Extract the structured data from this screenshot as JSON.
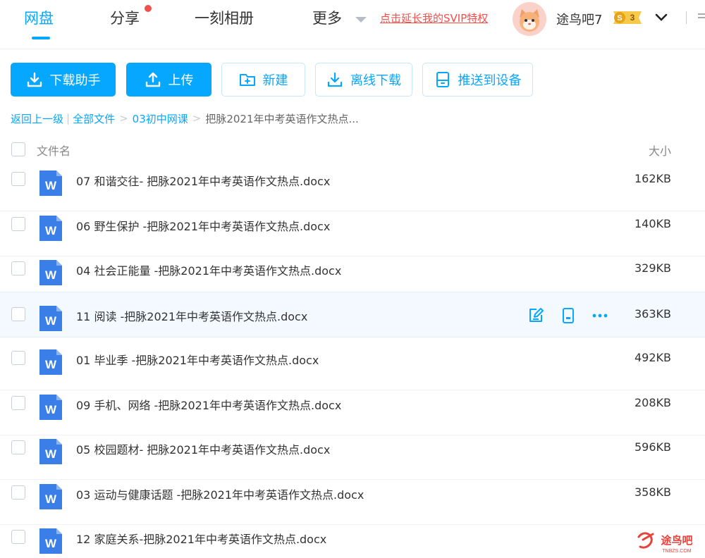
{
  "nav": {
    "items": [
      {
        "label": "网盘",
        "active": true
      },
      {
        "label": "分享",
        "has_dot": true
      },
      {
        "label": "一刻相册"
      },
      {
        "label": "更多"
      }
    ],
    "svip_link": "点击延长我的SVIP特权",
    "username": "途鸟吧7",
    "level_badge": {
      "symbol": "S",
      "level": "3"
    }
  },
  "toolbar": [
    {
      "label": "下载助手",
      "icon": "download-icon",
      "style": "primary"
    },
    {
      "label": "上传",
      "icon": "upload-icon",
      "style": "primary"
    },
    {
      "label": "新建",
      "icon": "new-folder-icon",
      "style": "outline"
    },
    {
      "label": "离线下载",
      "icon": "offline-download-icon",
      "style": "outline"
    },
    {
      "label": "推送到设备",
      "icon": "push-device-icon",
      "style": "outline"
    }
  ],
  "breadcrumb": {
    "back": "返回上一级",
    "all_files": "全部文件",
    "folder": "03初中网课",
    "current": "把脉2021年中考英语作文热点..."
  },
  "list_header": {
    "name": "文件名",
    "size": "大小"
  },
  "files": [
    {
      "icon": "word-doc-icon",
      "name": "07 和谐交往- 把脉2021年中考英语作文热点.docx",
      "size": "162KB"
    },
    {
      "icon": "word-doc-icon",
      "name": "06 野生保护 -把脉2021年中考英语作文热点.docx",
      "size": "140KB"
    },
    {
      "icon": "word-doc-icon",
      "name": "04 社会正能量 -把脉2021年中考英语作文热点.docx",
      "size": "329KB"
    },
    {
      "icon": "word-doc-icon",
      "name": "11 阅读 -把脉2021年中考英语作文热点.docx",
      "size": "363KB",
      "hovered": true,
      "actions": [
        "edit-icon",
        "phone-icon",
        "more-icon"
      ]
    },
    {
      "icon": "word-doc-icon",
      "name": "01 毕业季 -把脉2021年中考英语作文热点.docx",
      "size": "492KB"
    },
    {
      "icon": "word-doc-icon",
      "name": "09 手机、网络 -把脉2021年中考英语作文热点.docx",
      "size": "208KB"
    },
    {
      "icon": "word-doc-icon",
      "name": "05 校园题材- 把脉2021年中考英语作文热点.docx",
      "size": "596KB"
    },
    {
      "icon": "word-doc-icon",
      "name": "03 运动与健康话题 -把脉2021年中考英语作文热点.docx",
      "size": "358KB"
    },
    {
      "icon": "word-doc-icon",
      "name": "12 家庭关系-把脉2021年中考英语作文热点.docx",
      "size": ""
    }
  ],
  "watermark": {
    "text": "途鸟吧",
    "sub": "TNBZS.COM"
  },
  "colors": {
    "accent": "#06a7ff",
    "red": "#f0504b",
    "word_blue": "#3a7ee8"
  }
}
